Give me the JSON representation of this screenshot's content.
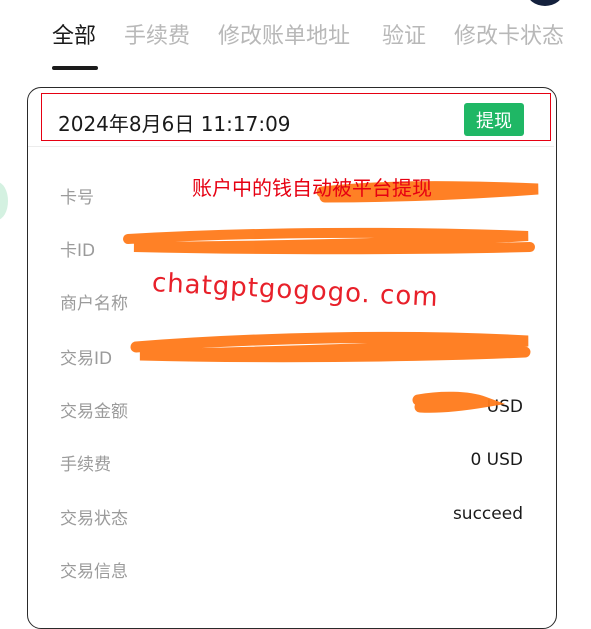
{
  "tabs": [
    {
      "label": "全部",
      "active": true
    },
    {
      "label": "手续费",
      "active": false
    },
    {
      "label": "修改账单地址",
      "active": false
    },
    {
      "label": "验证",
      "active": false
    },
    {
      "label": "修改卡状态",
      "active": false
    }
  ],
  "record": {
    "datetime": "2024年8月6日 11:17:09",
    "type_badge": "提现"
  },
  "annotation": "账户中的钱自动被平台提现",
  "watermark": "chatgptgogogo. com",
  "details": [
    {
      "label": "卡号",
      "value": ""
    },
    {
      "label": "卡ID",
      "value": ""
    },
    {
      "label": "商户名称",
      "value": ""
    },
    {
      "label": "交易ID",
      "value": ""
    },
    {
      "label": "交易金额",
      "value": "USD"
    },
    {
      "label": "手续费",
      "value": "0 USD"
    },
    {
      "label": "交易状态",
      "value": "succeed"
    },
    {
      "label": "交易信息",
      "value": ""
    }
  ],
  "colors": {
    "badge_green": "#1fb765",
    "annotation_red": "#e60012",
    "redaction_orange": "#ff7a1a"
  }
}
